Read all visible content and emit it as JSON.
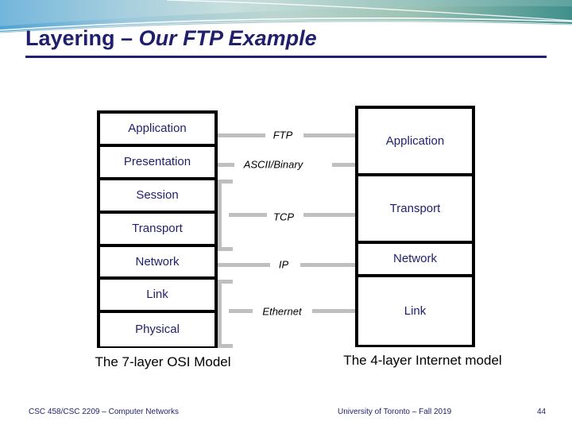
{
  "slide": {
    "title_plain": "Layering – ",
    "title_emphasis": "Our FTP Example",
    "accent_color": "#1f1f6e",
    "connector_color": "#bfbfbf",
    "border_color": "#000000"
  },
  "osi_stack": {
    "caption": "The 7-layer OSI Model",
    "layers": [
      {
        "label": "Application"
      },
      {
        "label": "Presentation"
      },
      {
        "label": "Session"
      },
      {
        "label": "Transport"
      },
      {
        "label": "Network"
      },
      {
        "label": "Link"
      },
      {
        "label": "Physical"
      }
    ]
  },
  "internet_stack": {
    "caption": "The 4-layer Internet model",
    "layers": [
      {
        "label": "Application"
      },
      {
        "label": "Transport"
      },
      {
        "label": "Network"
      },
      {
        "label": "Link"
      }
    ]
  },
  "protocols": [
    {
      "label": "FTP"
    },
    {
      "label": "ASCII/Binary"
    },
    {
      "label": "TCP"
    },
    {
      "label": "IP"
    },
    {
      "label": "Ethernet"
    }
  ],
  "footer": {
    "left": "CSC 458/CSC 2209 – Computer Networks",
    "center": "University of Toronto – Fall 2019",
    "page": "44"
  }
}
